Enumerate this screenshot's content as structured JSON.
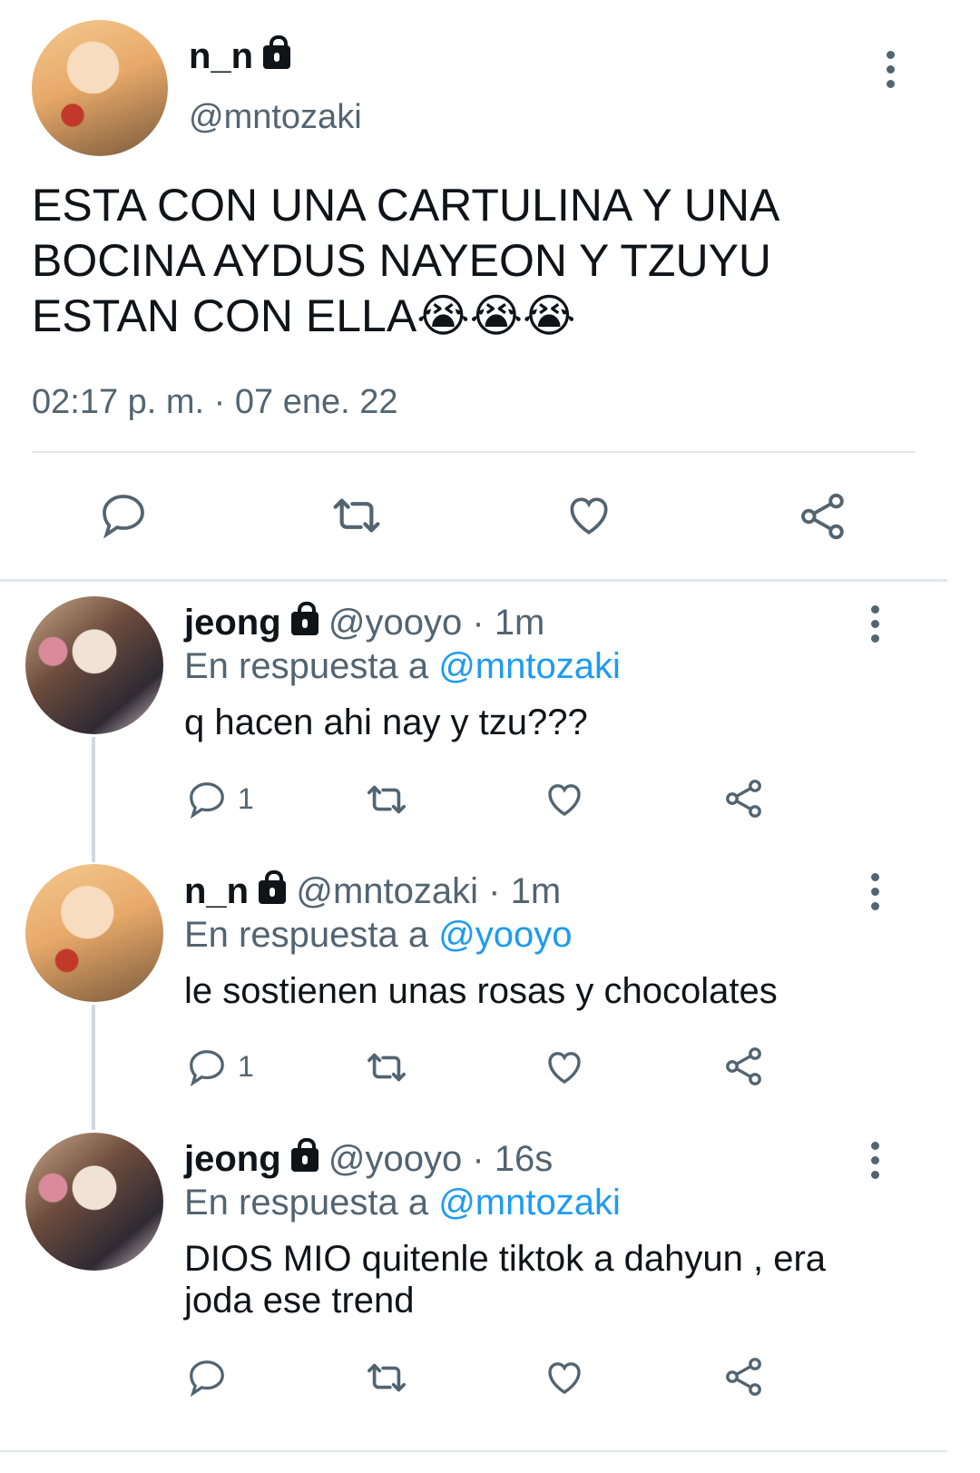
{
  "main_tweet": {
    "name": "n_n",
    "handle": "@mntozaki",
    "text": "ESTA CON UNA CARTULINA Y UNA BOCINA AYDUS NAYEON Y TZUYU ESTAN CON ELLA😭😭😭",
    "timestamp": "02:17 p. m. · 07 ene. 22",
    "actions": [
      "reply-icon",
      "retweet-icon",
      "like-icon",
      "share-icon"
    ]
  },
  "replies": [
    {
      "name": "jeong",
      "handle_time": "@yooyo · 1m",
      "reply_prefix": "En respuesta a",
      "reply_to": "@mntozaki",
      "text": "q hacen ahi nay y tzu???",
      "reply_count": "1"
    },
    {
      "name": "n_n",
      "handle_time": "@mntozaki · 1m",
      "reply_prefix": "En respuesta a",
      "reply_to": "@yooyo",
      "text": "le sostienen unas rosas y chocolates",
      "reply_count": "1"
    },
    {
      "name": "jeong",
      "handle_time": "@yooyo · 16s",
      "reply_prefix": "En respuesta a",
      "reply_to": "@mntozaki",
      "text": "DIOS MIO quitenle tiktok a dahyun , era joda ese trend",
      "reply_count": ""
    }
  ],
  "colors": {
    "text": "#0f1419",
    "secondary": "#536471",
    "link": "#1d9bf0",
    "divider": "#e1e8ed"
  }
}
